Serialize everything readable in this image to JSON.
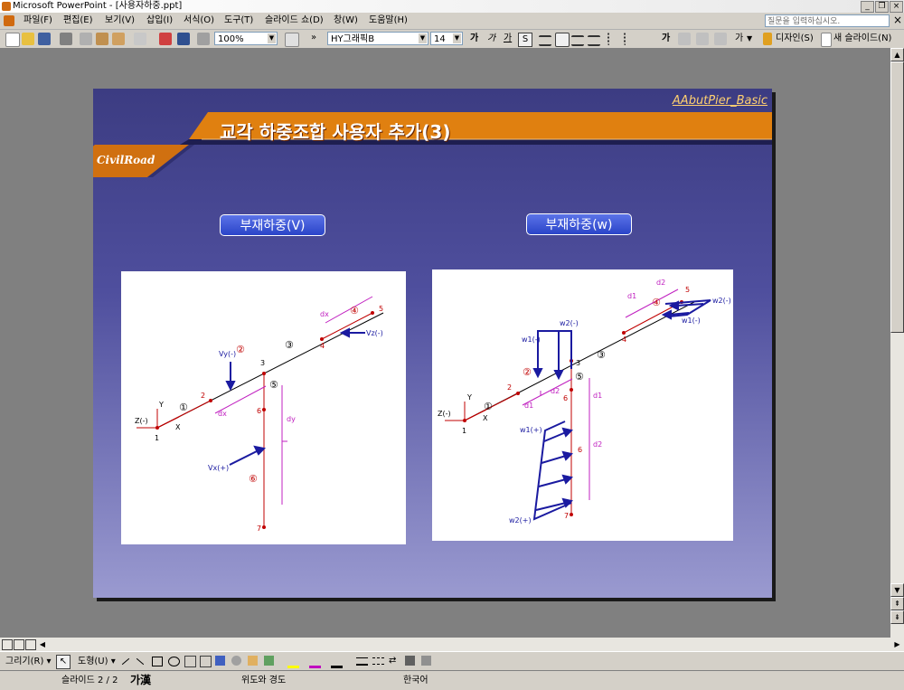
{
  "window": {
    "title": "Microsoft PowerPoint - [사용자하중.ppt]",
    "buttons": [
      "_",
      "❐",
      "×"
    ]
  },
  "menu": {
    "items": [
      "파일(F)",
      "편집(E)",
      "보기(V)",
      "삽입(I)",
      "서식(O)",
      "도구(T)",
      "슬라이드 쇼(D)",
      "창(W)",
      "도움말(H)"
    ],
    "ask_placeholder": "질문을 입력하십시오.",
    "close": "×"
  },
  "toolbar": {
    "zoom": "100%",
    "font": "HY그래픽B",
    "size": "14",
    "bold": "가",
    "italic": "가",
    "underline": "가",
    "shadow": "S",
    "grow": "가",
    "fontcolor": "가",
    "design": "디자인(S)",
    "new_slide": "새 슬라이드(N)"
  },
  "slide": {
    "watermark": "AAbutPier_Basic",
    "title": "교각 하중조합 사용자 추가(3)",
    "logo": "CivilRoad",
    "pill_left": "부재하중(V)",
    "pill_right": "부재하중(w)"
  },
  "diagram_left": {
    "labels": {
      "z": "Z(-)",
      "y": "Y",
      "x": "X",
      "n1": "1",
      "n2": "2",
      "n3": "3",
      "n4": "4",
      "n5": "5",
      "n6": "6",
      "n7": "7",
      "m1": "①",
      "m2": "②",
      "m3": "③",
      "m4": "④",
      "m5": "⑤",
      "m6": "⑥",
      "vy": "Vy(-)",
      "vz": "Vz(-)",
      "vx": "Vx(+)",
      "dx1": "dx",
      "dx2": "dx",
      "dy": "dy"
    }
  },
  "diagram_right": {
    "labels": {
      "z": "Z(-)",
      "y": "Y",
      "x": "X",
      "n1": "1",
      "n2": "2",
      "n3": "3",
      "n4": "4",
      "n5": "5",
      "n6a": "6",
      "n6b": "6",
      "n7": "7",
      "m1": "①",
      "m2": "②",
      "m3": "③",
      "m4": "④",
      "m5": "⑤",
      "w1m": "w1(-)",
      "w2m": "w2(-)",
      "w1p": "w1(+)",
      "w2p": "w2(+)",
      "w2m_r": "w2(-)",
      "w1m_r": "w1(-)",
      "d1a": "d1",
      "d2a": "d2",
      "d1b": "d1",
      "d2b": "d2",
      "d1c": "d1",
      "d2c": "d2"
    }
  },
  "drawbar": {
    "draw": "그리기(R) ▾",
    "shapes": "도형(U) ▾"
  },
  "status": {
    "slide": "슬라이드 2 / 2",
    "ime": "가漢",
    "design": "위도와 경도",
    "lang": "한국어"
  },
  "colors": {
    "accent_orange": "#e07a10",
    "slide_blue": "#4a4a96",
    "line_red": "#c00000",
    "dim_magenta": "#c020c0",
    "load_blue": "#1a1aa0"
  }
}
